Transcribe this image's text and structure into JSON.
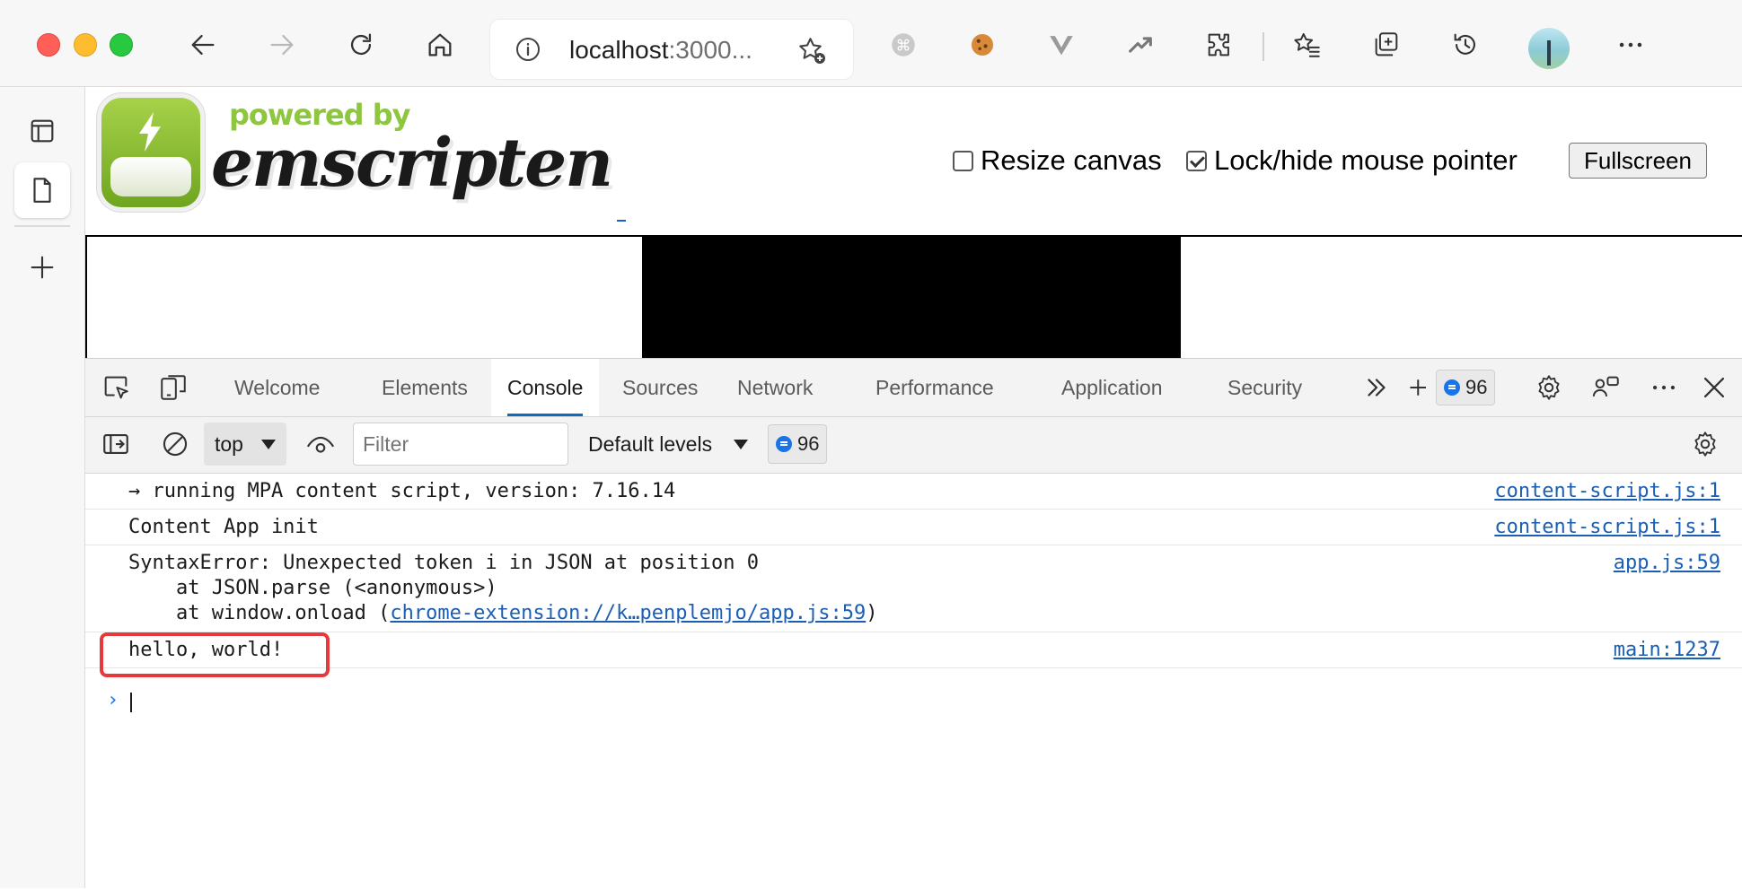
{
  "browser": {
    "address": {
      "host": "localhost",
      "rest": ":3000..."
    },
    "colors": {
      "close": "#ff5f57",
      "minimize": "#febc2e",
      "zoom": "#28c840"
    },
    "toolbar_icons": [
      "back-icon",
      "forward-icon",
      "refresh-icon",
      "home-icon",
      "extension-command-icon",
      "cookie-icon",
      "vue-devtools-icon",
      "trend-icon",
      "extensions-icon",
      "favorites-icon",
      "collections-icon",
      "history-icon",
      "profile-avatar",
      "more-icon"
    ]
  },
  "sidebar": {
    "items": [
      "vertical-tabs-icon",
      "page-tab-icon",
      "add-tab-icon"
    ]
  },
  "page": {
    "logo_powered": "powered by",
    "logo_word": "emscripten",
    "resize_canvas": "Resize canvas",
    "lock_pointer": "Lock/hide mouse pointer",
    "fullscreen": "Fullscreen",
    "resize_checked": false,
    "lock_checked": true
  },
  "devtools": {
    "tabs": [
      "Welcome",
      "Elements",
      "Console",
      "Sources",
      "Network",
      "Performance",
      "Application",
      "Security"
    ],
    "active_tab": "Console",
    "issues_count": "96",
    "toolbar": {
      "context": "top",
      "filter_placeholder": "Filter",
      "levels": "Default levels",
      "count": "96"
    },
    "messages": [
      {
        "text": "→ running MPA content script, version: 7.16.14",
        "source": "content-script.js:1"
      },
      {
        "text": "Content App init",
        "source": "content-script.js:1"
      },
      {
        "line1": "SyntaxError: Unexpected token i in JSON at position 0",
        "line2": "    at JSON.parse (<anonymous>)",
        "line3_pre": "    at window.onload (",
        "line3_link": "chrome-extension://k…penplemjo/app.js:59",
        "line3_post": ")",
        "source": "app.js:59"
      },
      {
        "text": "hello, world!",
        "source": "main:1237"
      }
    ],
    "prompt": "›"
  }
}
